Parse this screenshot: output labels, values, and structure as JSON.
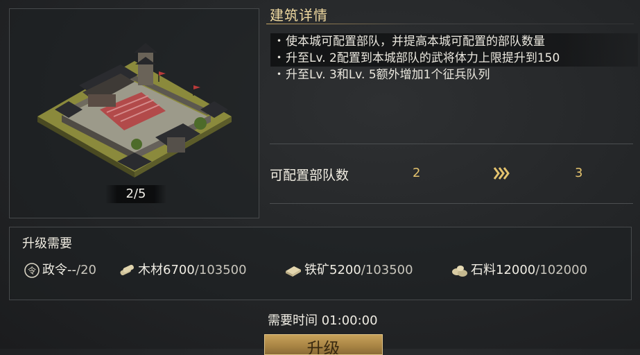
{
  "building": {
    "level_text": "2/5"
  },
  "detail": {
    "title": "建筑详情",
    "items": [
      "使本城可配置部队，并提高本城可配置的部队数量",
      "升至Lv. 2配置到本城部队的武将体力上限提升到150",
      "升至Lv. 3和Lv. 5额外增加1个征兵队列"
    ],
    "bullet": "・"
  },
  "stat": {
    "label": "可配置部队数",
    "current": "2",
    "next": "3"
  },
  "requirements": {
    "title": "升级需要",
    "resources": [
      {
        "icon": "decree-icon",
        "name": "政令",
        "have": "--",
        "need": "/20"
      },
      {
        "icon": "wood-icon",
        "name": "木材",
        "have": "6700",
        "need": "/103500"
      },
      {
        "icon": "iron-icon",
        "name": "铁矿",
        "have": "5200",
        "need": "/103500"
      },
      {
        "icon": "stone-icon",
        "name": "石料",
        "have": "12000",
        "need": "/102000"
      }
    ]
  },
  "time": {
    "label": "需要时间 01:00:00"
  },
  "button": {
    "label": "升级"
  },
  "colors": {
    "accent_gold": "#e4c36e",
    "title_gold": "#efd9a0"
  }
}
